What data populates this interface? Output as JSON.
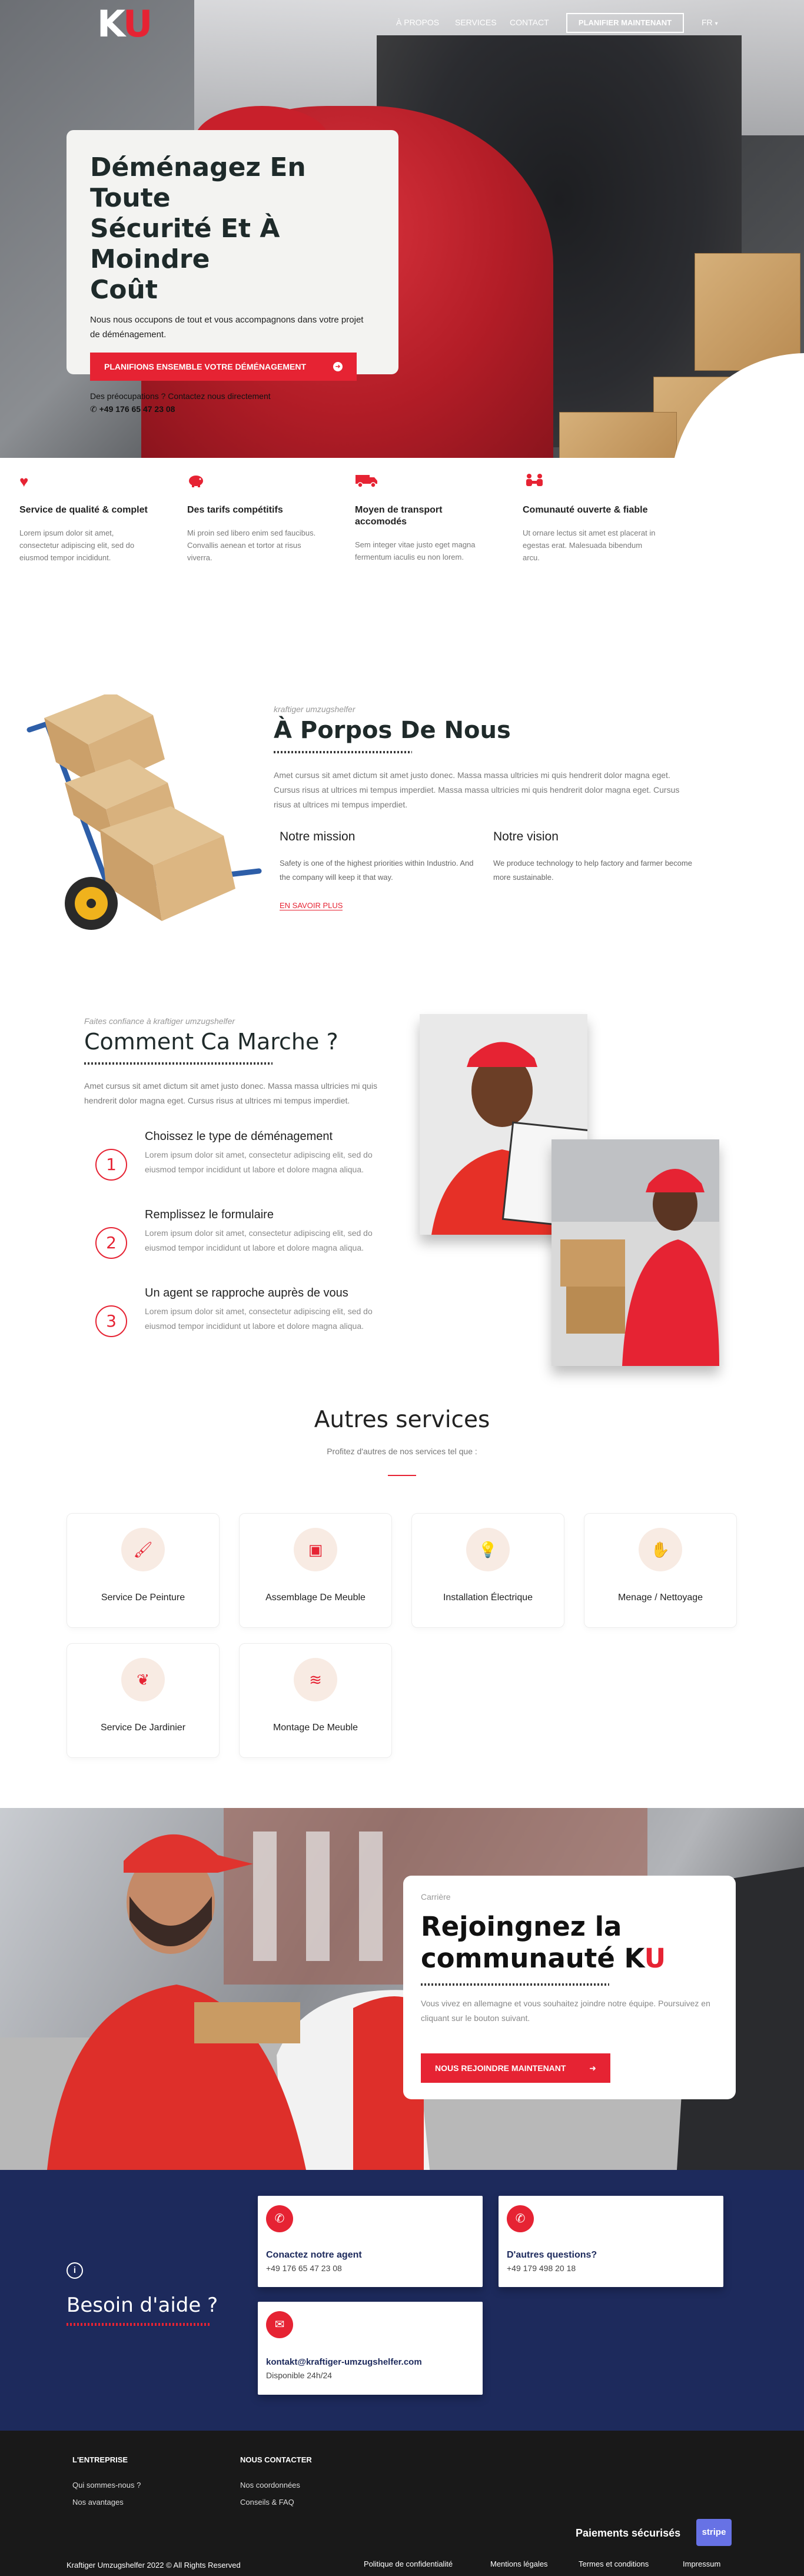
{
  "nav": {
    "logo_k": "K",
    "logo_u": "U",
    "links": [
      "À PROPOS",
      "SERVICES",
      "CONTACT"
    ],
    "cta": "PLANIFIER MAINTENANT",
    "lang": "FR"
  },
  "hero": {
    "title_1": "Déménagez En Toute",
    "title_2": "Sécurité Et À Moindre",
    "title_3": "Coût",
    "subtitle": "Nous nous occupons de tout et vous accompagnons dans votre projet de déménagement.",
    "button": "PLANIFIONS ENSEMBLE VOTRE DÉMÉNAGEMENT",
    "question": "Des préocupations ? Contactez nous directement",
    "phone": "+49 176 65 47 23 08"
  },
  "features": [
    {
      "icon": "heart-icon",
      "title": "Service de qualité & complet",
      "text": "Lorem ipsum dolor sit amet, consectetur adipiscing elit, sed do eiusmod tempor incididunt."
    },
    {
      "icon": "piggy-bank-icon",
      "title": "Des tarifs compétitifs",
      "text": "Mi proin sed libero enim sed faucibus. Convallis aenean et tortor at risus viverra."
    },
    {
      "icon": "truck-icon",
      "title": "Moyen de transport accomodés",
      "text": "Sem integer vitae justo eget magna fermentum iaculis eu non lorem."
    },
    {
      "icon": "people-icon",
      "title": "Comunauté ouverte & fiable",
      "text": "Ut ornare lectus sit amet est placerat in egestas erat. Malesuada bibendum arcu."
    }
  ],
  "about": {
    "kicker": "kraftiger umzugshelfer",
    "title": "À Porpos De Nous",
    "text": "Amet cursus sit amet dictum sit amet justo donec. Massa massa ultricies mi quis hendrerit dolor magna eget. Cursus risus at ultrices mi tempus imperdiet. Massa massa ultricies mi quis hendrerit dolor magna eget. Cursus risus at ultrices mi tempus imperdiet.",
    "mission_title": "Notre mission",
    "mission_text": "Safety is one of the highest priorities within Industrio. And the company will keep it that way.",
    "vision_title": "Notre vision",
    "vision_text": "We produce technology to help factory and farmer become more sustainable.",
    "more": "EN SAVOIR PLUS"
  },
  "how": {
    "kicker": "Faites confiance à kraftiger umzugshelfer",
    "title": "Comment Ca Marche ?",
    "text": "Amet cursus sit amet dictum sit amet justo donec. Massa massa ultricies mi quis hendrerit dolor magna eget. Cursus risus at ultrices mi tempus imperdiet.",
    "steps": [
      {
        "num": "1",
        "title": "Choissez le type de déménagement",
        "text": "Lorem ipsum dolor sit amet, consectetur adipiscing elit, sed do eiusmod tempor incididunt ut labore et dolore magna aliqua."
      },
      {
        "num": "2",
        "title": "Remplissez le formulaire",
        "text": "Lorem ipsum dolor sit amet, consectetur adipiscing elit, sed do eiusmod tempor incididunt ut labore et dolore magna aliqua."
      },
      {
        "num": "3",
        "title": "Un agent se rapproche auprès de vous",
        "text": "Lorem ipsum dolor sit amet, consectetur adipiscing elit, sed do eiusmod tempor incididunt ut labore et dolore magna aliqua."
      }
    ]
  },
  "services": {
    "title": "Autres services",
    "subtitle": "Profitez d'autres de nos services tel que :",
    "items": [
      {
        "icon": "paint-roller-icon",
        "label": "Service De Peinture"
      },
      {
        "icon": "toolbox-icon",
        "label": "Assemblage De Meuble"
      },
      {
        "icon": "lightbulb-icon",
        "label": "Installation Électrique"
      },
      {
        "icon": "hand-cleaning-icon",
        "label": "Menage / Nettoyage"
      },
      {
        "icon": "leaf-icon",
        "label": "Service De Jardinier"
      },
      {
        "icon": "layers-icon",
        "label": "Montage De Meuble"
      }
    ]
  },
  "join": {
    "kicker": "Carrière",
    "title_1": "Rejoingnez la",
    "title_2": "communauté K",
    "title_3": "U",
    "text": "Vous vivez en allemagne et vous souhaitez joindre notre équipe. Poursuivez en cliquant sur le bouton suivant.",
    "button": "NOUS REJOINDRE MAINTENANT"
  },
  "help": {
    "title": "Besoin d'aide ?",
    "cards": [
      {
        "icon": "phone-icon",
        "title": "Conactez notre agent",
        "sub": "+49 176 65 47 23 08"
      },
      {
        "icon": "phone-icon",
        "title": "D'autres questions?",
        "sub": "+49 179 498 20 18"
      },
      {
        "icon": "email-icon",
        "title": "kontakt@kraftiger-umzugshelfer.com",
        "sub": "Disponible 24h/24"
      }
    ]
  },
  "footer": {
    "col1_title": "L'ENTREPRISE",
    "col1_links": [
      "Qui sommes-nous ?",
      "Nos avantages"
    ],
    "col2_title": "NOUS CONTACTER",
    "col2_links": [
      "Nos coordonnées",
      "Conseils & FAQ"
    ],
    "payments": "Paiements sécurisés",
    "stripe": "stripe",
    "copyright": "Kraftiger Umzugshelfer 2022 © All Rights Reserved",
    "legal": [
      "Politique de confidentialité",
      "Mentions légales",
      "Termes et conditions",
      "Impressum"
    ]
  }
}
